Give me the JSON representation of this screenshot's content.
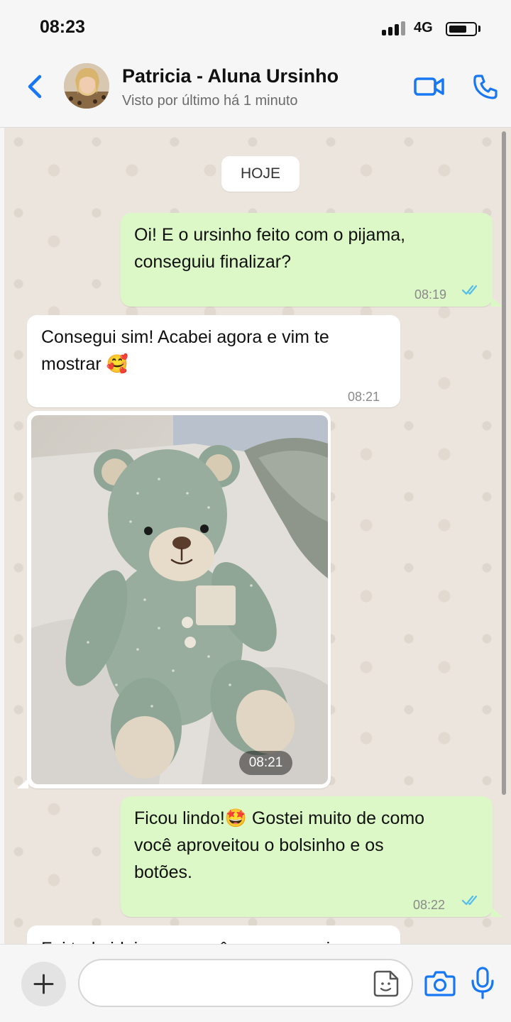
{
  "status_bar": {
    "time": "08:23",
    "network": "4G"
  },
  "header": {
    "contact_name": "Patricia - Aluna Ursinho",
    "last_seen": "Visto por último há 1 minuto"
  },
  "chat": {
    "date_chip": "HOJE",
    "messages": [
      {
        "direction": "out",
        "text": "Oi! E o ursinho feito com o pijama,\nconseguiu finalizar?",
        "time": "08:19",
        "status": "read"
      },
      {
        "direction": "in",
        "text": "Consegui sim! Acabei agora e vim te\nmostrar 🥰",
        "time": "08:21"
      },
      {
        "direction": "in",
        "type": "image",
        "description": "teddy bear",
        "time": "08:21"
      },
      {
        "direction": "out",
        "text": "Ficou lindo!🤩  Gostei muito de como\nvocê aproveitou o bolsinho e os\nbotões.",
        "time": "08:22",
        "status": "read"
      },
      {
        "direction": "in",
        "text": "Foi tudo ideia sua, você que me ensinou",
        "time": ""
      }
    ]
  },
  "input_bar": {
    "placeholder": ""
  },
  "colors": {
    "accent": "#1877f2",
    "outgoing_bubble": "#dcf8c6",
    "incoming_bubble": "#ffffff",
    "read_ticks": "#53bdeb",
    "chat_background": "#ece5dd"
  },
  "icons": {
    "back": "chevron-left-icon",
    "video": "video-camera-icon",
    "call": "phone-icon",
    "plus": "plus-icon",
    "sticker": "sticker-icon",
    "camera": "camera-icon",
    "mic": "microphone-icon"
  }
}
